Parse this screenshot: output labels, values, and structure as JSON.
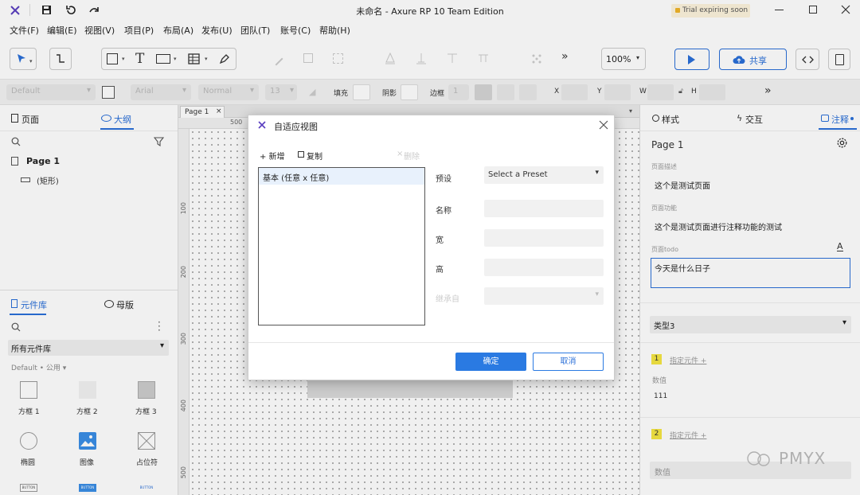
{
  "window": {
    "title": "未命名 - Axure RP 10 Team Edition",
    "trial_badge": "Trial expiring soon"
  },
  "menu": [
    "文件(F)",
    "编辑(E)",
    "视图(V)",
    "项目(P)",
    "布局(A)",
    "发布(U)",
    "团队(T)",
    "账号(C)",
    "帮助(H)"
  ],
  "toolbar": {
    "zoom": "100%",
    "share_label": "共享",
    "more": "»"
  },
  "formatbar": {
    "style": "Default",
    "font": "Arial",
    "weight": "Normal",
    "size": "13",
    "fill_label": "填充",
    "shadow_label": "阴影",
    "border_label": "边框",
    "border_width": "1",
    "x_label": "X",
    "y_label": "Y",
    "w_label": "W",
    "h_label": "H"
  },
  "leftpanel": {
    "tab_pages": "页面",
    "tab_outline": "大纲",
    "tree_page": "Page 1",
    "tree_child": "(矩形)",
    "tab_library": "元件库",
    "tab_masters": "母版",
    "library_select": "所有元件库",
    "library_group": "Default • 公用 ▾",
    "widgets": [
      "方框 1",
      "方框 2",
      "方框 3",
      "椭圆",
      "图像",
      "占位符"
    ],
    "btn_tiny": "BUTTON"
  },
  "canvas": {
    "tab": "Page 1",
    "ruler_top": [
      "500"
    ],
    "ruler_left": [
      "100",
      "200",
      "300",
      "400",
      "500"
    ]
  },
  "rightpanel": {
    "tab_style": "样式",
    "tab_interaction": "交互",
    "tab_notes": "注释",
    "page_name": "Page 1",
    "desc_label": "页面描述",
    "desc_value": "这个是测试页面",
    "func_label": "页面功能",
    "func_value": "这个是测试页面进行注释功能的测试",
    "todo_label": "页面todo",
    "todo_value": "今天是什么日子",
    "type_select": "类型3",
    "item1_num": "1",
    "item1_link": "指定元件 +",
    "value_label": "数值",
    "value_value": "111",
    "item2_num": "2",
    "item2_link": "指定元件 +",
    "value_placeholder": "数值",
    "watermark": "PMYX"
  },
  "dialog": {
    "title": "自适应视图",
    "add": "+ 新增",
    "copy": "复制",
    "delete": "删除",
    "list_item": "基本 (任意 x 任意)",
    "preset_label": "预设",
    "preset_value": "Select a Preset",
    "name_label": "名称",
    "width_label": "宽",
    "height_label": "高",
    "inherit_label": "继承自",
    "ok": "确定",
    "cancel": "取消"
  },
  "colors": {
    "accent": "#2a6fd8",
    "badge": "#f5e642"
  }
}
